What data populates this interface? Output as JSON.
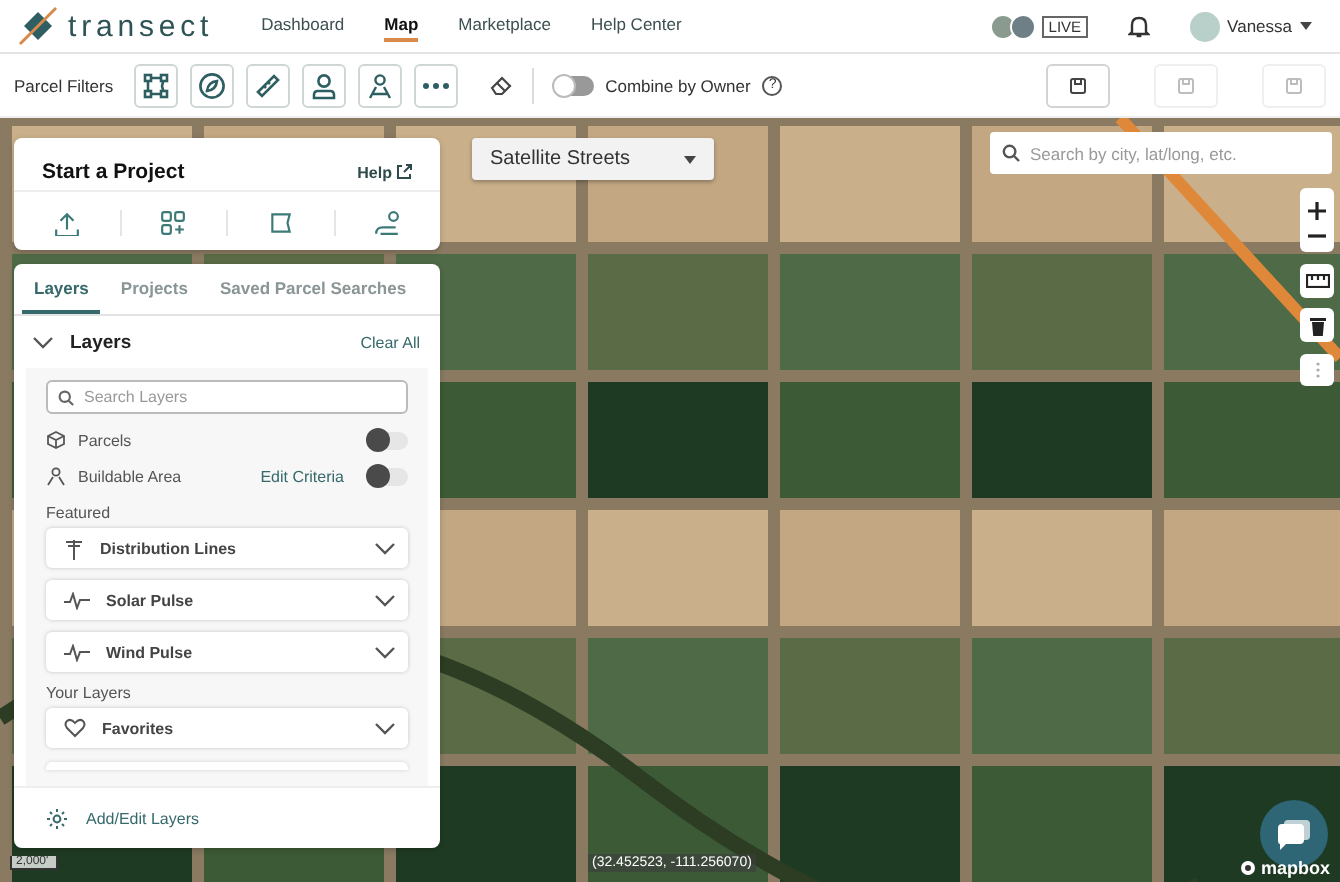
{
  "header": {
    "logo": "transect",
    "nav": [
      {
        "label": "Dashboard",
        "selected": false
      },
      {
        "label": "Map",
        "selected": true
      },
      {
        "label": "Marketplace",
        "selected": false
      },
      {
        "label": "Help Center",
        "selected": false
      }
    ],
    "live_badge": "LIVE",
    "user": "Vanessa"
  },
  "filter_bar": {
    "label": "Parcel Filters",
    "combine": {
      "label": "Combine by Owner",
      "on": false,
      "help": "?"
    },
    "actions": [
      {
        "disabled": false
      },
      {
        "disabled": true
      },
      {
        "disabled": true
      }
    ]
  },
  "project_card": {
    "title": "Start a Project",
    "help": "Help"
  },
  "layers_panel": {
    "tabs": [
      {
        "label": "Layers",
        "selected": true
      },
      {
        "label": "Projects",
        "selected": false
      },
      {
        "label": "Saved Parcel Searches",
        "selected": false
      }
    ],
    "section": {
      "title": "Layers",
      "expanded": true,
      "clear": "Clear All"
    },
    "search": {
      "placeholder": "Search Layers"
    },
    "toggles": [
      {
        "kind": "parcels",
        "label": "Parcels",
        "on": false
      },
      {
        "kind": "buildable",
        "label": "Buildable Area",
        "on": false,
        "action": "Edit Criteria"
      }
    ],
    "featured_label": "Featured",
    "featured": [
      {
        "kind": "lines",
        "label": "Distribution Lines",
        "expanded": false
      },
      {
        "kind": "pulse",
        "label": "Solar Pulse",
        "expanded": false
      },
      {
        "kind": "pulse",
        "label": "Wind Pulse",
        "expanded": false
      }
    ],
    "your_layers_label": "Your Layers",
    "your_layers": [
      {
        "kind": "heart",
        "label": "Favorites",
        "expanded": false
      }
    ],
    "footer": "Add/Edit Layers"
  },
  "map": {
    "style_select": "Satellite Streets",
    "search": {
      "placeholder": "Search by city, lat/long, etc."
    },
    "scale": "2,000'",
    "coordinates": "(32.452523, -111.256070)",
    "attribution": "mapbox"
  }
}
